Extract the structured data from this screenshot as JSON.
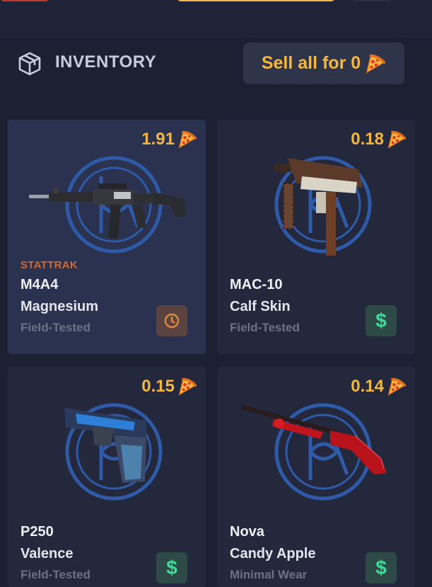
{
  "header": {
    "title": "INVENTORY",
    "sell_all_label": "Sell all for 0"
  },
  "items": [
    {
      "price": "1.91",
      "stattrak": "STATTRAK",
      "weapon": "M4A4",
      "skin": "Magnesium",
      "wear": "Field-Tested",
      "action": "clock-icon"
    },
    {
      "price": "0.18",
      "stattrak": "",
      "weapon": "MAC-10",
      "skin": "Calf Skin",
      "wear": "Field-Tested",
      "action": "dollar-icon"
    },
    {
      "price": "0.15",
      "stattrak": "",
      "weapon": "P250",
      "skin": "Valence",
      "wear": "Field-Tested",
      "action": "dollar-icon"
    },
    {
      "price": "0.14",
      "stattrak": "",
      "weapon": "Nova",
      "skin": "Candy Apple",
      "wear": "Minimal Wear",
      "action": "dollar-icon"
    }
  ],
  "sell_symbol": "$",
  "colors": {
    "background": "#1c2033",
    "card": "#23283d",
    "card_selected": "#2a3250",
    "price": "#f5b73d",
    "stattrak": "#cf6a35",
    "sell_green": "#3ddc97"
  }
}
